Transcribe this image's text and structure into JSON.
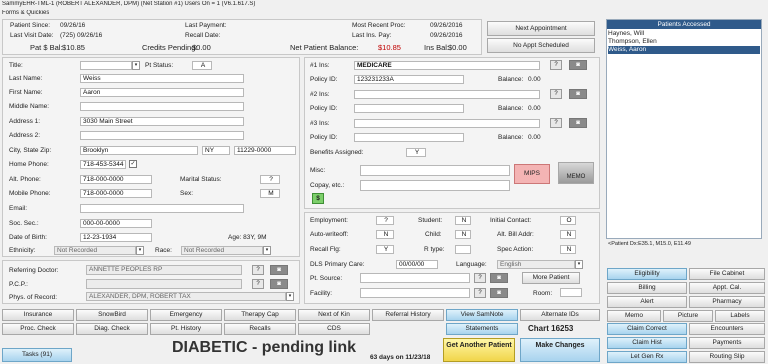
{
  "window": {
    "title": "SammyEHR-TML-1 (ROBERT ALEXANDER, DPM) (Net Station #1)  Users On = 1 (V6.1.617.S)",
    "menu": "Forms & Quickies"
  },
  "summary": {
    "patient_since_label": "Patient Since:",
    "patient_since": "09/26/16",
    "last_visit_label": "Last Visit Date:",
    "last_visit": "(725) 09/26/16",
    "pat_bal_label": "Pat $ Bal:",
    "pat_bal": "$10.85",
    "last_payment_label": "Last Payment:",
    "recall_date_label": "Recall Date:",
    "credits_label": "Credits Pending:",
    "credits": "$0.00",
    "recent_proc_label": "Most Recent Proc:",
    "recent_proc": "09/26/2016",
    "last_ins_pay_label": "Last Ins. Pay:",
    "last_ins_pay": "09/26/2016",
    "net_bal_label": "Net Patient Balance:",
    "net_bal": "$10.85",
    "ins_bal_label": "Ins Bal:",
    "ins_bal": "$0.00"
  },
  "appointments": {
    "next_label": "Next Appointment",
    "none_label": "No Appt Scheduled"
  },
  "patient": {
    "title_label": "Title:",
    "title": "",
    "pt_status_label": "Pt Status:",
    "pt_status": "A",
    "last_name_label": "Last Name:",
    "last_name": "Weiss",
    "first_name_label": "First Name:",
    "first_name": "Aaron",
    "middle_name_label": "Middle Name:",
    "middle_name": "",
    "address1_label": "Address 1:",
    "address1": "3030 Main Street",
    "address2_label": "Address 2:",
    "address2": "",
    "csz_label": "City, State Zip:",
    "city": "Brooklyn",
    "state": "NY",
    "zip": "11229-0000",
    "home_phone_label": "Home Phone:",
    "home_phone": "718-453-5344",
    "alt_phone_label": "Alt. Phone:",
    "alt_phone": "718-000-0000",
    "marital_label": "Marital Status:",
    "marital": "?",
    "mobile_label": "Mobile Phone:",
    "mobile": "718-000-0000",
    "sex_label": "Sex:",
    "sex": "M",
    "email_label": "Email:",
    "email": "",
    "ssn_label": "Soc. Sec.:",
    "ssn": "000-00-0000",
    "dob_label": "Date of Birth:",
    "dob": "12-23-1934",
    "age": "Age: 83Y, 9M",
    "ethnicity_label": "Ethnicity:",
    "ethnicity": "Not Recorded",
    "race_label": "Race:",
    "race": "Not Recorded"
  },
  "referral": {
    "ref_doc_label": "Referring Doctor:",
    "ref_doc": "ANNETTE PEOPLES RP",
    "pcp_label": "P.C.P.:",
    "pcp": "",
    "phys_label": "Phys. of Record:",
    "phys": "ALEXANDER, DPM, ROBERT  TAX"
  },
  "insurance": {
    "ins1_label": "#1 Ins:",
    "ins1": "MEDICARE",
    "policy_label": "Policy ID:",
    "policy1": "123231233A",
    "balance_label": "Balance:",
    "balance1": "0.00",
    "ins2_label": "#2 Ins:",
    "ins2": "",
    "policy2": "",
    "balance2": "0.00",
    "ins3_label": "#3 Ins:",
    "ins3": "",
    "policy3": "",
    "balance3": "0.00",
    "benefits_label": "Benefits Assigned:",
    "benefits": "Y",
    "misc_label": "Misc:",
    "copay_label": "Copay, etc.:",
    "dollar": "$",
    "mips": "MIPS",
    "memo": "MEMO"
  },
  "status": {
    "employment_label": "Employment:",
    "employment": "?",
    "student_label": "Student:",
    "student": "N",
    "initial_contact_label": "Initial Contact:",
    "initial_contact": "O",
    "auto_writeoff_label": "Auto-writeoff:",
    "auto_writeoff": "N",
    "child_label": "Child:",
    "child": "N",
    "alt_bill_label": "Alt. Bill Addr:",
    "alt_bill": "N",
    "recall_flg_label": "Recall Flg:",
    "recall_flg": "Y",
    "rtype_label": "R type:",
    "rtype": "",
    "spec_action_label": "Spec Action:",
    "spec_action": "N",
    "dls_label": "DLS Primary Care:",
    "dls": "00/00/00",
    "language_label": "Language:",
    "language": "English",
    "pt_source_label": "Pt. Source:",
    "facility_label": "Facility:",
    "more_patient": "More Patient",
    "room_label": "Room:"
  },
  "patients_accessed": {
    "title": "Patients Accessed",
    "items": [
      "Haynes, Will",
      "Thompson, Ellen",
      "Weiss, Aaron"
    ],
    "selected": 2
  },
  "diagnosis_line": "<Patient Dx:E35.1, M15.0, E11.49",
  "right_buttons": [
    [
      "Eligibility",
      "File Cabinet"
    ],
    [
      "Billing",
      "Appt. Cal."
    ],
    [
      "Alert",
      "Pharmacy"
    ],
    [
      "Memo",
      "Picture",
      "Labels"
    ],
    [
      "Claim Correct",
      "Encounters"
    ],
    [
      "Claim Hist",
      "Payments"
    ],
    [
      "Let Gen Rx",
      "Routing Slip"
    ]
  ],
  "bottom_row1": [
    "Insurance",
    "SnowBird",
    "Emergency",
    "Therapy Cap",
    "Next of Kin",
    "Referral History",
    "View SamNote",
    "Alternate IDs"
  ],
  "bottom_row2": [
    "Proc. Check",
    "Diag. Check",
    "Pt. History",
    "Recalls",
    "CDS"
  ],
  "statements": "Statements",
  "chart": "Chart 16253",
  "tasks": "Tasks (91)",
  "alert_text": "DIABETIC - pending link",
  "days_text": "63 days on 11/23/18",
  "get_another": "Get Another Patient",
  "make_changes": "Make Changes",
  "colors": {
    "accent_blue": "#a8d3ee",
    "header_blue": "#2f5a8a",
    "alert_yellow": "#f1d54a",
    "balance_red": "#c00000"
  }
}
